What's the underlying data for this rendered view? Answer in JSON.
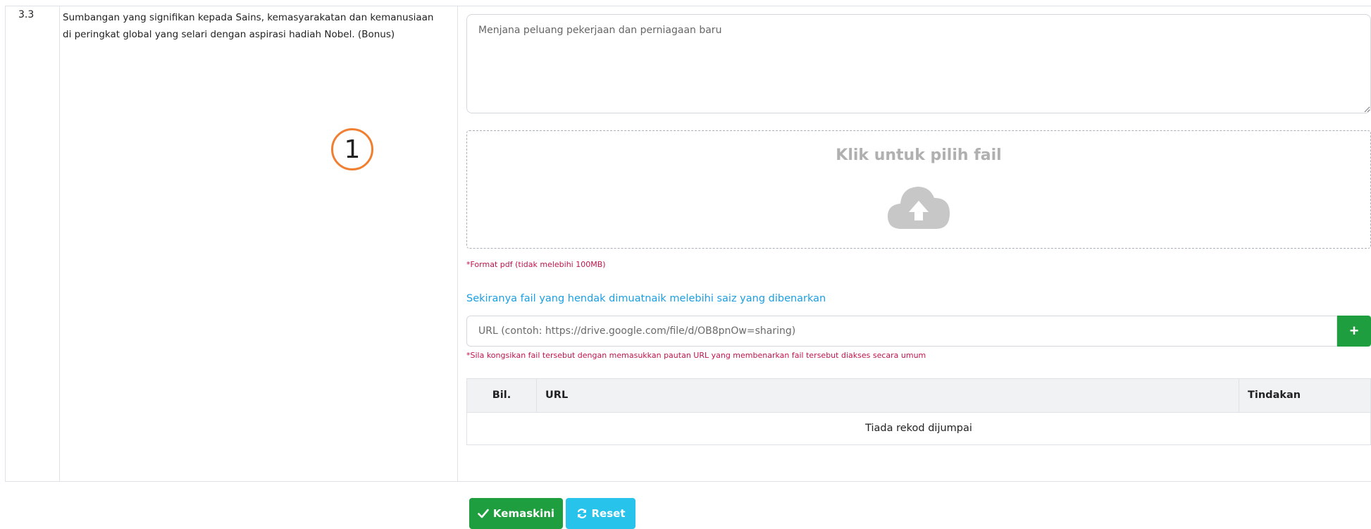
{
  "item": {
    "number": "3.3",
    "description": "Sumbangan yang signifikan kepada Sains, kemasyarakatan dan kemanusiaan di peringkat global yang selari dengan aspirasi hadiah Nobel. (Bonus)"
  },
  "annotation": {
    "marker": "1"
  },
  "textarea": {
    "placeholder": "Menjana peluang pekerjaan dan perniagaan baru"
  },
  "upload": {
    "label": "Klik untuk pilih fail",
    "format_note": "*Format pdf (tidak melebihi 100MB)"
  },
  "url_section": {
    "link_text": "Sekiranya fail yang hendak dimuatnaik melebihi saiz yang dibenarkan",
    "input_placeholder": "URL (contoh: https://drive.google.com/file/d/OB8pnOw=sharing)",
    "add_label": "+",
    "share_note": "*Sila kongsikan fail tersebut dengan memasukkan pautan URL yang membenarkan fail tersebut diakses secara umum"
  },
  "url_table": {
    "headers": [
      "Bil.",
      "URL",
      "Tindakan"
    ],
    "empty_text": "Tiada rekod dijumpai"
  },
  "buttons": {
    "update_label": "Kemaskini",
    "reset_label": "Reset"
  },
  "colors": {
    "success": "#1e9e3e",
    "info": "#27c3ea",
    "link": "#1a9fe3",
    "note": "#c0144a",
    "annotation": "#f07f32"
  }
}
